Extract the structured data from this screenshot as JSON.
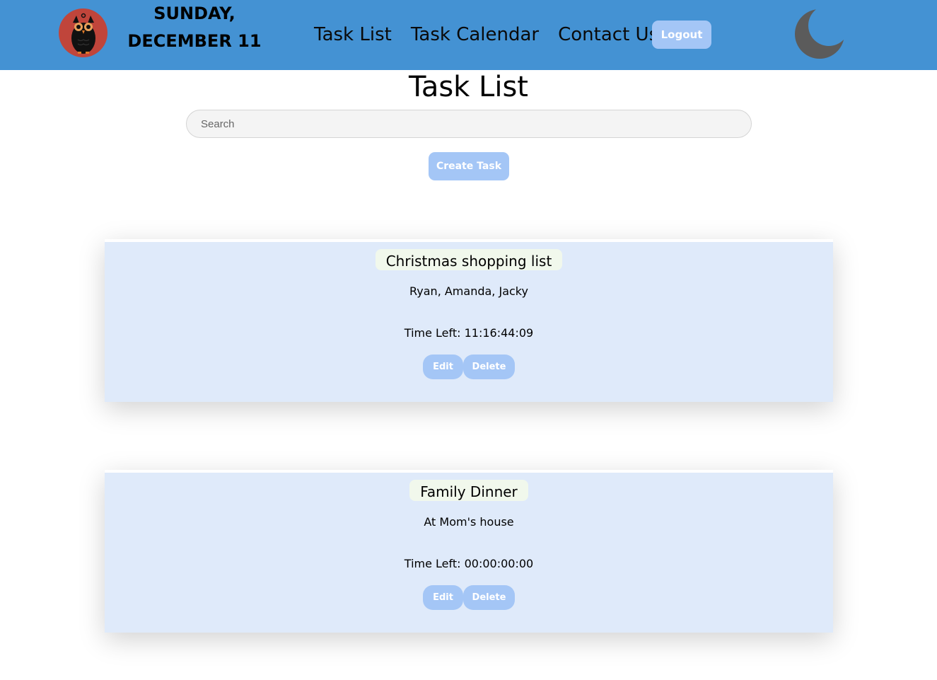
{
  "header": {
    "date_line1": "SUNDAY,",
    "date_line2": "DECEMBER 11",
    "nav": [
      {
        "label": "Task List"
      },
      {
        "label": "Task Calendar"
      },
      {
        "label": "Contact Us"
      }
    ],
    "logout_label": "Logout",
    "logo_icon": "owl-icon",
    "theme_icon": "moon-icon"
  },
  "main": {
    "title": "Task List",
    "search_placeholder": "Search",
    "create_label": "Create Task"
  },
  "tasks": [
    {
      "title": "Christmas shopping list",
      "description": "Ryan, Amanda, Jacky",
      "time_left": "Time Left: 11:16:44:09",
      "edit_label": "Edit",
      "delete_label": "Delete"
    },
    {
      "title": "Family Dinner",
      "description": "At Mom's house",
      "time_left": "Time Left: 00:00:00:00",
      "edit_label": "Edit",
      "delete_label": "Delete"
    }
  ],
  "colors": {
    "header_bg": "#4492d3",
    "button_bg": "#a4c6f6",
    "card_bg": "#dfeafa",
    "card_title_bg": "#f1f8ec",
    "logo_bg": "#c0453b",
    "moon": "#5b5b5b"
  }
}
